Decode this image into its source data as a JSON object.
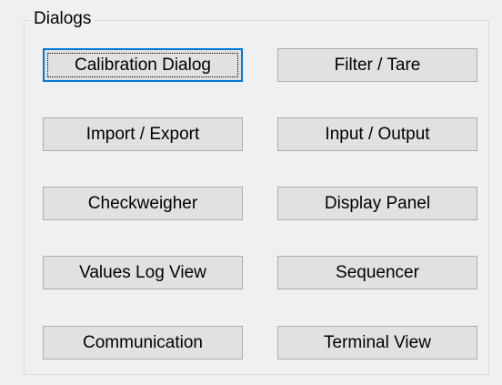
{
  "group": {
    "title": "Dialogs"
  },
  "buttons": {
    "calibration": "Calibration Dialog",
    "filter_tare": "Filter / Tare",
    "import_export": "Import / Export",
    "input_output": "Input / Output",
    "checkweigher": "Checkweigher",
    "display_panel": "Display Panel",
    "values_log_view": "Values Log View",
    "sequencer": "Sequencer",
    "communication": "Communication",
    "terminal_view": "Terminal View"
  },
  "colors": {
    "window_background": "#f0f0f0",
    "button_face": "#e1e1e1",
    "button_border": "#adadad",
    "focus_border": "#0078d7"
  }
}
